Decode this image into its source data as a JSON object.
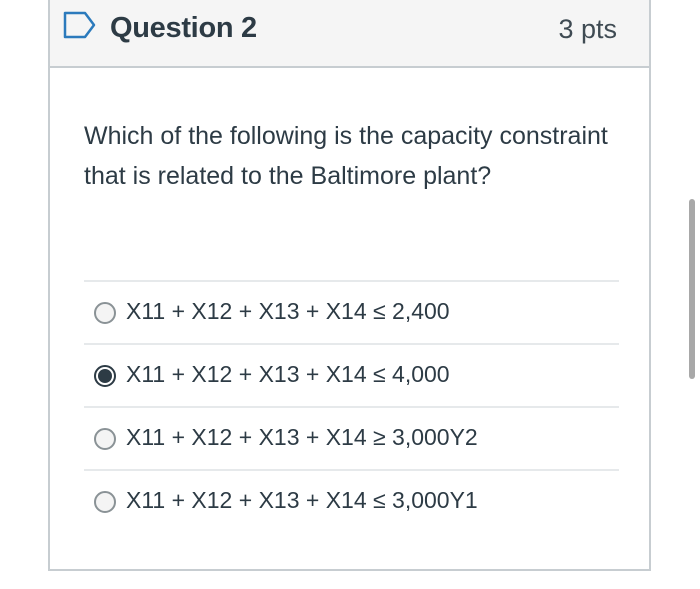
{
  "question": {
    "title": "Question 2",
    "points": "3 pts",
    "flag_icon": "flag-outline-icon",
    "text": "Which of the following is the capacity constraint that is related to the Baltimore plant?"
  },
  "answers": [
    {
      "label": "X11 + X12 + X13 + X14 ≤ 2,400",
      "selected": false
    },
    {
      "label": "X11 + X12 + X13 + X14 ≤ 4,000",
      "selected": true
    },
    {
      "label": "X11 + X12 + X13 + X14 ≥ 3,000Y2",
      "selected": false
    },
    {
      "label": "X11 + X12 + X13 + X14 ≤ 3,000Y1",
      "selected": false
    }
  ],
  "colors": {
    "header_bg": "#f5f5f5",
    "border": "#c7cdd1",
    "text": "#2d3b45",
    "flag": "#2b7abc"
  }
}
